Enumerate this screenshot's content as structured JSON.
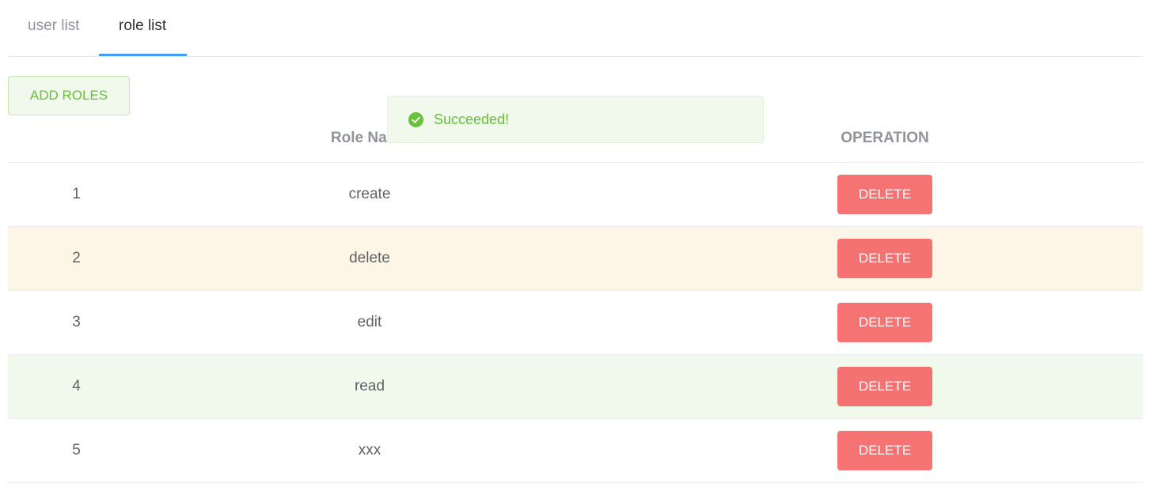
{
  "tabs": [
    {
      "label": "user list",
      "active": false
    },
    {
      "label": "role list",
      "active": true
    }
  ],
  "toolbar": {
    "add_label": "ADD ROLES"
  },
  "table": {
    "headers": [
      "",
      "Role Name",
      "OPERATION"
    ],
    "rows": [
      {
        "index": "1",
        "name": "create",
        "action": "DELETE"
      },
      {
        "index": "2",
        "name": "delete",
        "action": "DELETE"
      },
      {
        "index": "3",
        "name": "edit",
        "action": "DELETE"
      },
      {
        "index": "4",
        "name": "read",
        "action": "DELETE"
      },
      {
        "index": "5",
        "name": "xxx",
        "action": "DELETE"
      }
    ]
  },
  "toast": {
    "message": "Succeeded!",
    "icon": "success-check-icon"
  },
  "colors": {
    "accent": "#409eff",
    "success": "#67c23a",
    "danger": "#f56c6c",
    "warning_row": "#fdf5e6",
    "success_row": "#f0f9eb"
  }
}
